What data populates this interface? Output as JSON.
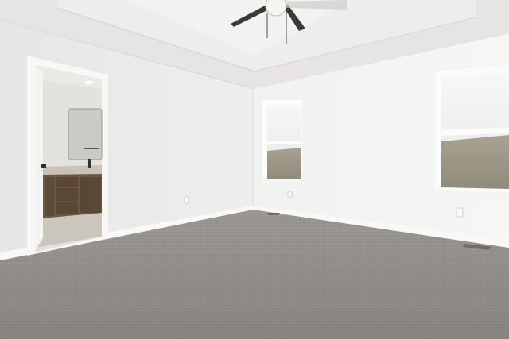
{
  "scene": {
    "kind": "photo",
    "subject": "empty bedroom",
    "colors": {
      "wall_left": "#ecebea",
      "wall_right": "#f3f3f2",
      "ceiling": "#e6e5e3",
      "tray_ceiling": "#f0efed",
      "carpet": "#8f8c89",
      "trim": "#f7f7f6",
      "window_frame": "#fbfbfb",
      "sky": "#f0f1f0",
      "field": "#9b9583",
      "vanity": "#6b5744",
      "bath_floor": "#cbc6bd",
      "fan_blade": "#3a3a38"
    }
  }
}
